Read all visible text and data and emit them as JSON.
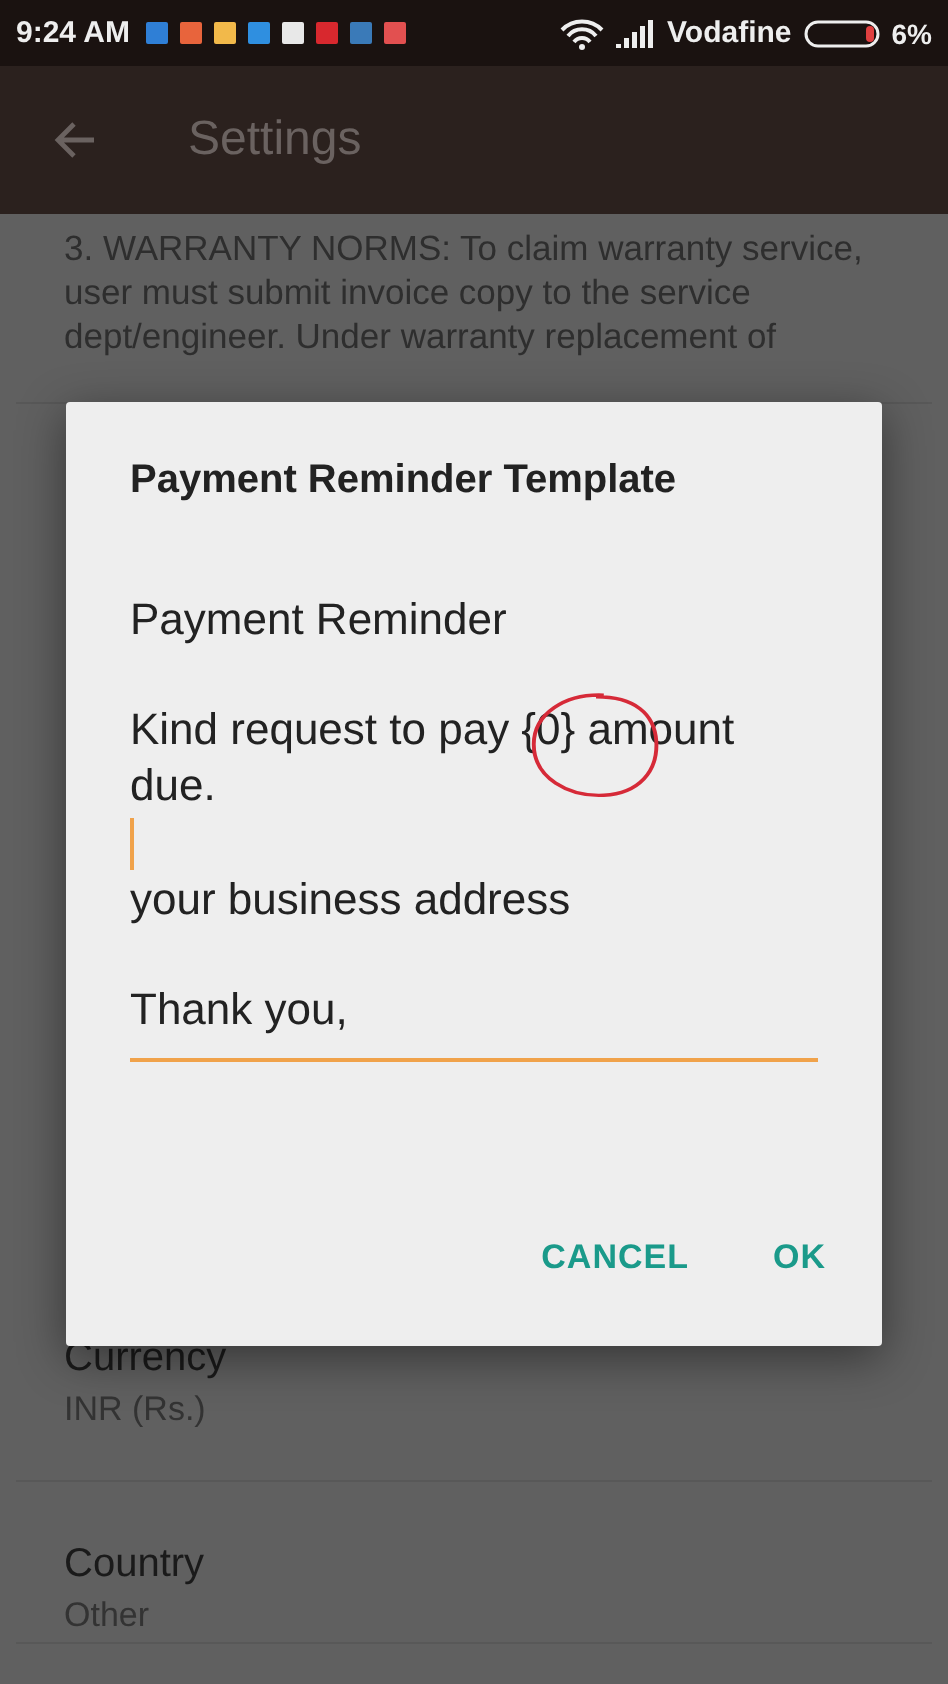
{
  "status_bar": {
    "time": "9:24 AM",
    "notification_icons": [
      {
        "color": "#2f7fd6"
      },
      {
        "color": "#e8643c"
      },
      {
        "color": "#f2b94a"
      },
      {
        "color": "#2f8fe0"
      },
      {
        "color": "#e8e8e8"
      },
      {
        "color": "#d8282e"
      },
      {
        "color": "#3a7ab8"
      },
      {
        "color": "#e25050"
      }
    ],
    "carrier": "Vodafine",
    "battery": "6%"
  },
  "toolbar": {
    "title": "Settings"
  },
  "settings": [
    {
      "kind": "text",
      "text": "3. WARRANTY NORMS: To claim warranty service, user must submit invoice copy to the service dept/engineer. Under warranty replacement of"
    },
    {
      "kind": "pair",
      "title": "Currency",
      "value": "INR (Rs.)"
    },
    {
      "kind": "pair",
      "title": "Country",
      "value": "Other"
    }
  ],
  "dialog": {
    "title": "Payment Reminder Template",
    "field": {
      "focused": true,
      "lines": [
        "Payment Reminder",
        "Kind request to pay {0} amount due.",
        "your business address",
        "Thank you,"
      ]
    },
    "buttons": [
      "CANCEL",
      "OK"
    ]
  }
}
